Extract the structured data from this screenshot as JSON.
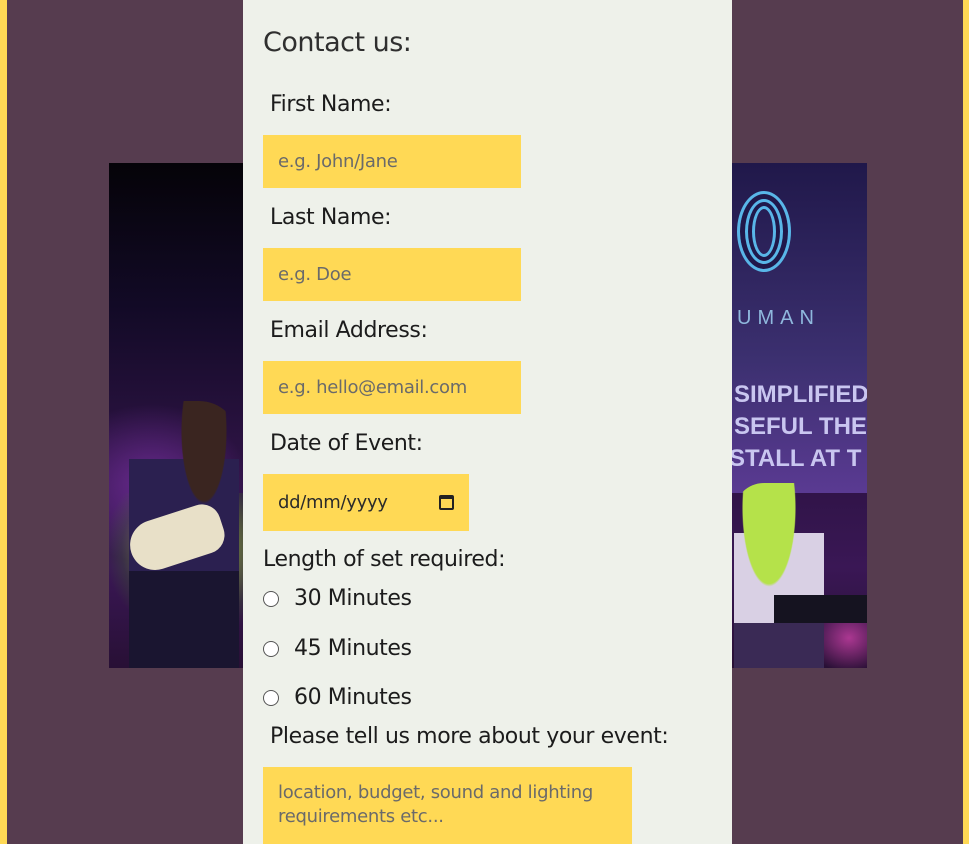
{
  "colors": {
    "page_background": "#563c4f",
    "accent_yellow": "#ffd955",
    "form_background": "#eef1ea"
  },
  "photo": {
    "brand_text": "UMAN",
    "screen_line_1": "SIMPLIFIED I",
    "screen_line_2": "SEFUL THEY",
    "screen_line_3": "STALL AT T"
  },
  "form": {
    "title": "Contact us:",
    "first_name": {
      "label": "First Name:",
      "placeholder": "e.g. John/Jane"
    },
    "last_name": {
      "label": "Last Name:",
      "placeholder": "e.g. Doe"
    },
    "email": {
      "label": "Email Address:",
      "placeholder": "e.g. hello@email.com"
    },
    "date": {
      "label": "Date of Event:",
      "value": "dd/mm/yyyy",
      "icon": "calendar-icon"
    },
    "set_length": {
      "label": "Length of set required:",
      "options": [
        "30 Minutes",
        "45 Minutes",
        "60 Minutes"
      ]
    },
    "details": {
      "label": "Please tell us more about your event:",
      "placeholder": "location, budget, sound and lighting requirements etc..."
    }
  }
}
